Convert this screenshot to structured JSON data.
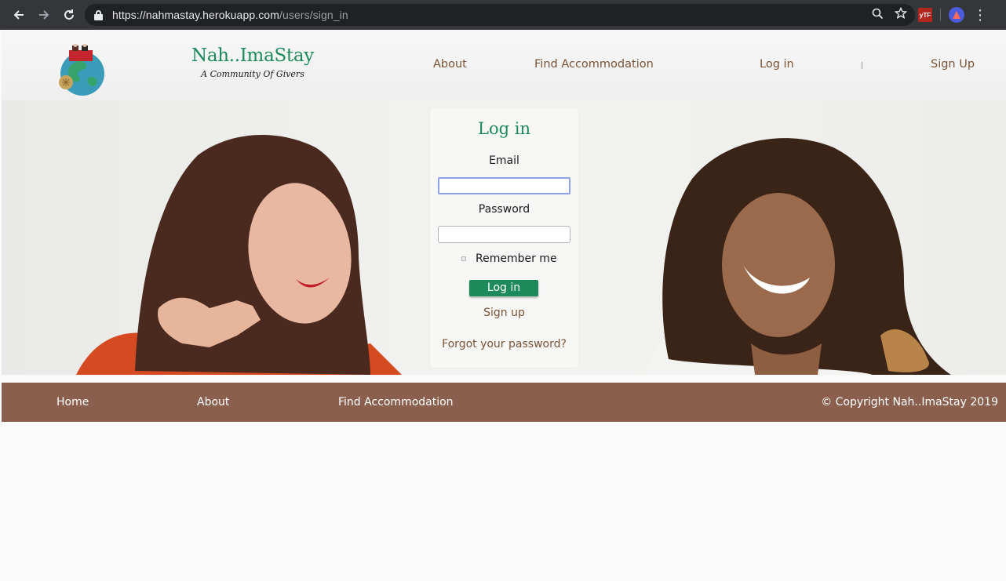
{
  "browser": {
    "url_host": "https://nahmastay.herokuapp.com",
    "url_path": "/users/sign_in",
    "ext_label": "yTF"
  },
  "header": {
    "brand_name": "Nah..ImaStay",
    "brand_tagline": "A Community Of Givers",
    "nav": {
      "about": "About",
      "find": "Find Accommodation",
      "login": "Log in",
      "signup": "Sign Up"
    }
  },
  "login_form": {
    "title": "Log in",
    "email_label": "Email",
    "email_value": "",
    "password_label": "Password",
    "password_value": "",
    "remember_label": "Remember me",
    "remember_checked": false,
    "submit_label": "Log in",
    "signup_link": "Sign up",
    "forgot_link": "Forgot your password?"
  },
  "footer": {
    "home": "Home",
    "about": "About",
    "find": "Find Accommodation",
    "copyright": "© Copyright Nah..ImaStay 2019"
  },
  "colors": {
    "brand_green": "#1d8a5c",
    "link_brown": "#7a5238",
    "footer_bg": "#8b5f4d"
  }
}
